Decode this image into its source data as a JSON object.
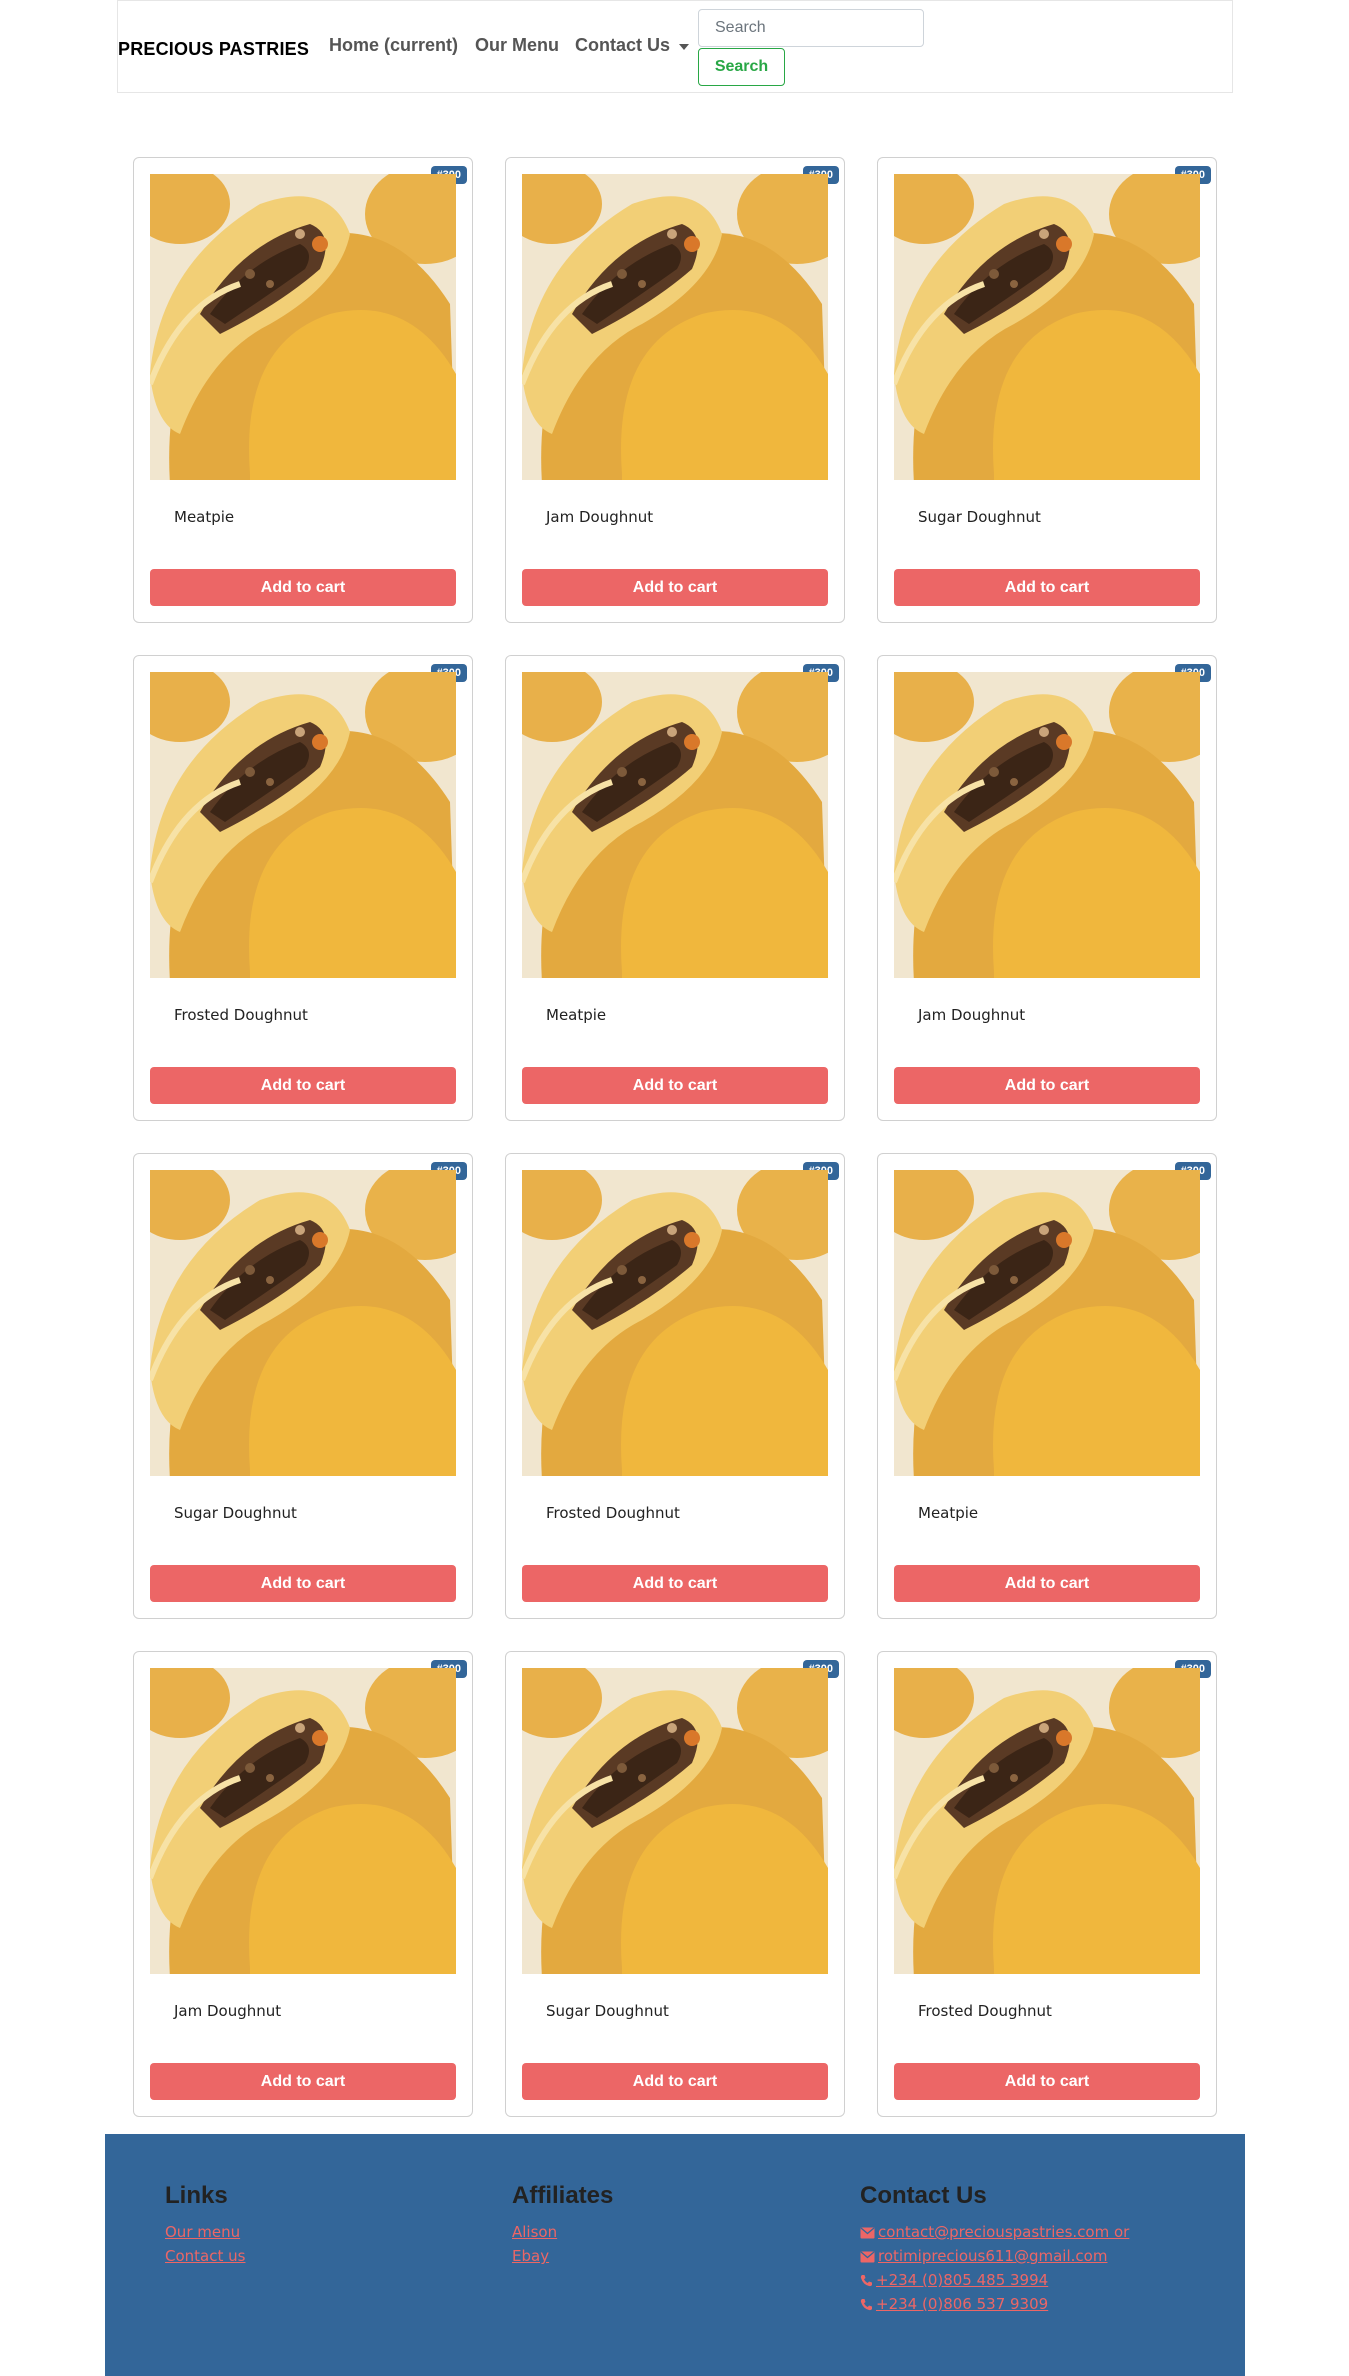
{
  "navbar": {
    "brand": "PRECIOUS PASTRIES",
    "home_label": "Home (current)",
    "menu_label": "Our Menu",
    "contact_label": "Contact Us",
    "search_placeholder": "Search",
    "search_button": "Search"
  },
  "products": [
    {
      "name": "Meatpie",
      "price": "#300",
      "button": "Add to cart"
    },
    {
      "name": "Jam Doughnut",
      "price": "#300",
      "button": "Add to cart"
    },
    {
      "name": "Sugar Doughnut",
      "price": "#300",
      "button": "Add to cart"
    },
    {
      "name": "Frosted Doughnut",
      "price": "#300",
      "button": "Add to cart"
    },
    {
      "name": "Meatpie",
      "price": "#300",
      "button": "Add to cart"
    },
    {
      "name": "Jam Doughnut",
      "price": "#300",
      "button": "Add to cart"
    },
    {
      "name": "Sugar Doughnut",
      "price": "#300",
      "button": "Add to cart"
    },
    {
      "name": "Frosted Doughnut",
      "price": "#300",
      "button": "Add to cart"
    },
    {
      "name": "Meatpie",
      "price": "#300",
      "button": "Add to cart"
    },
    {
      "name": "Jam Doughnut",
      "price": "#300",
      "button": "Add to cart"
    },
    {
      "name": "Sugar Doughnut",
      "price": "#300",
      "button": "Add to cart"
    },
    {
      "name": "Frosted Doughnut",
      "price": "#300",
      "button": "Add to cart"
    }
  ],
  "footer": {
    "links_heading": "Links",
    "links": [
      "Our menu",
      "Contact us"
    ],
    "affiliates_heading": "Affiliates",
    "affiliates": [
      "Alison",
      "Ebay"
    ],
    "contact_heading": "Contact Us",
    "contacts": [
      {
        "icon": "envelope-icon",
        "text": "contact@preciouspastries.com or"
      },
      {
        "icon": "envelope-icon",
        "text": "rotimiprecious611@gmail.com"
      },
      {
        "icon": "phone-icon",
        "text": "+234 (0)805 485 3994"
      },
      {
        "icon": "phone-icon",
        "text": "+234 (0)806 537 9309"
      }
    ]
  },
  "colors": {
    "accent_red": "#ec6666",
    "badge_blue": "#336699",
    "footer_bg": "#336699",
    "search_green": "#28a745"
  }
}
